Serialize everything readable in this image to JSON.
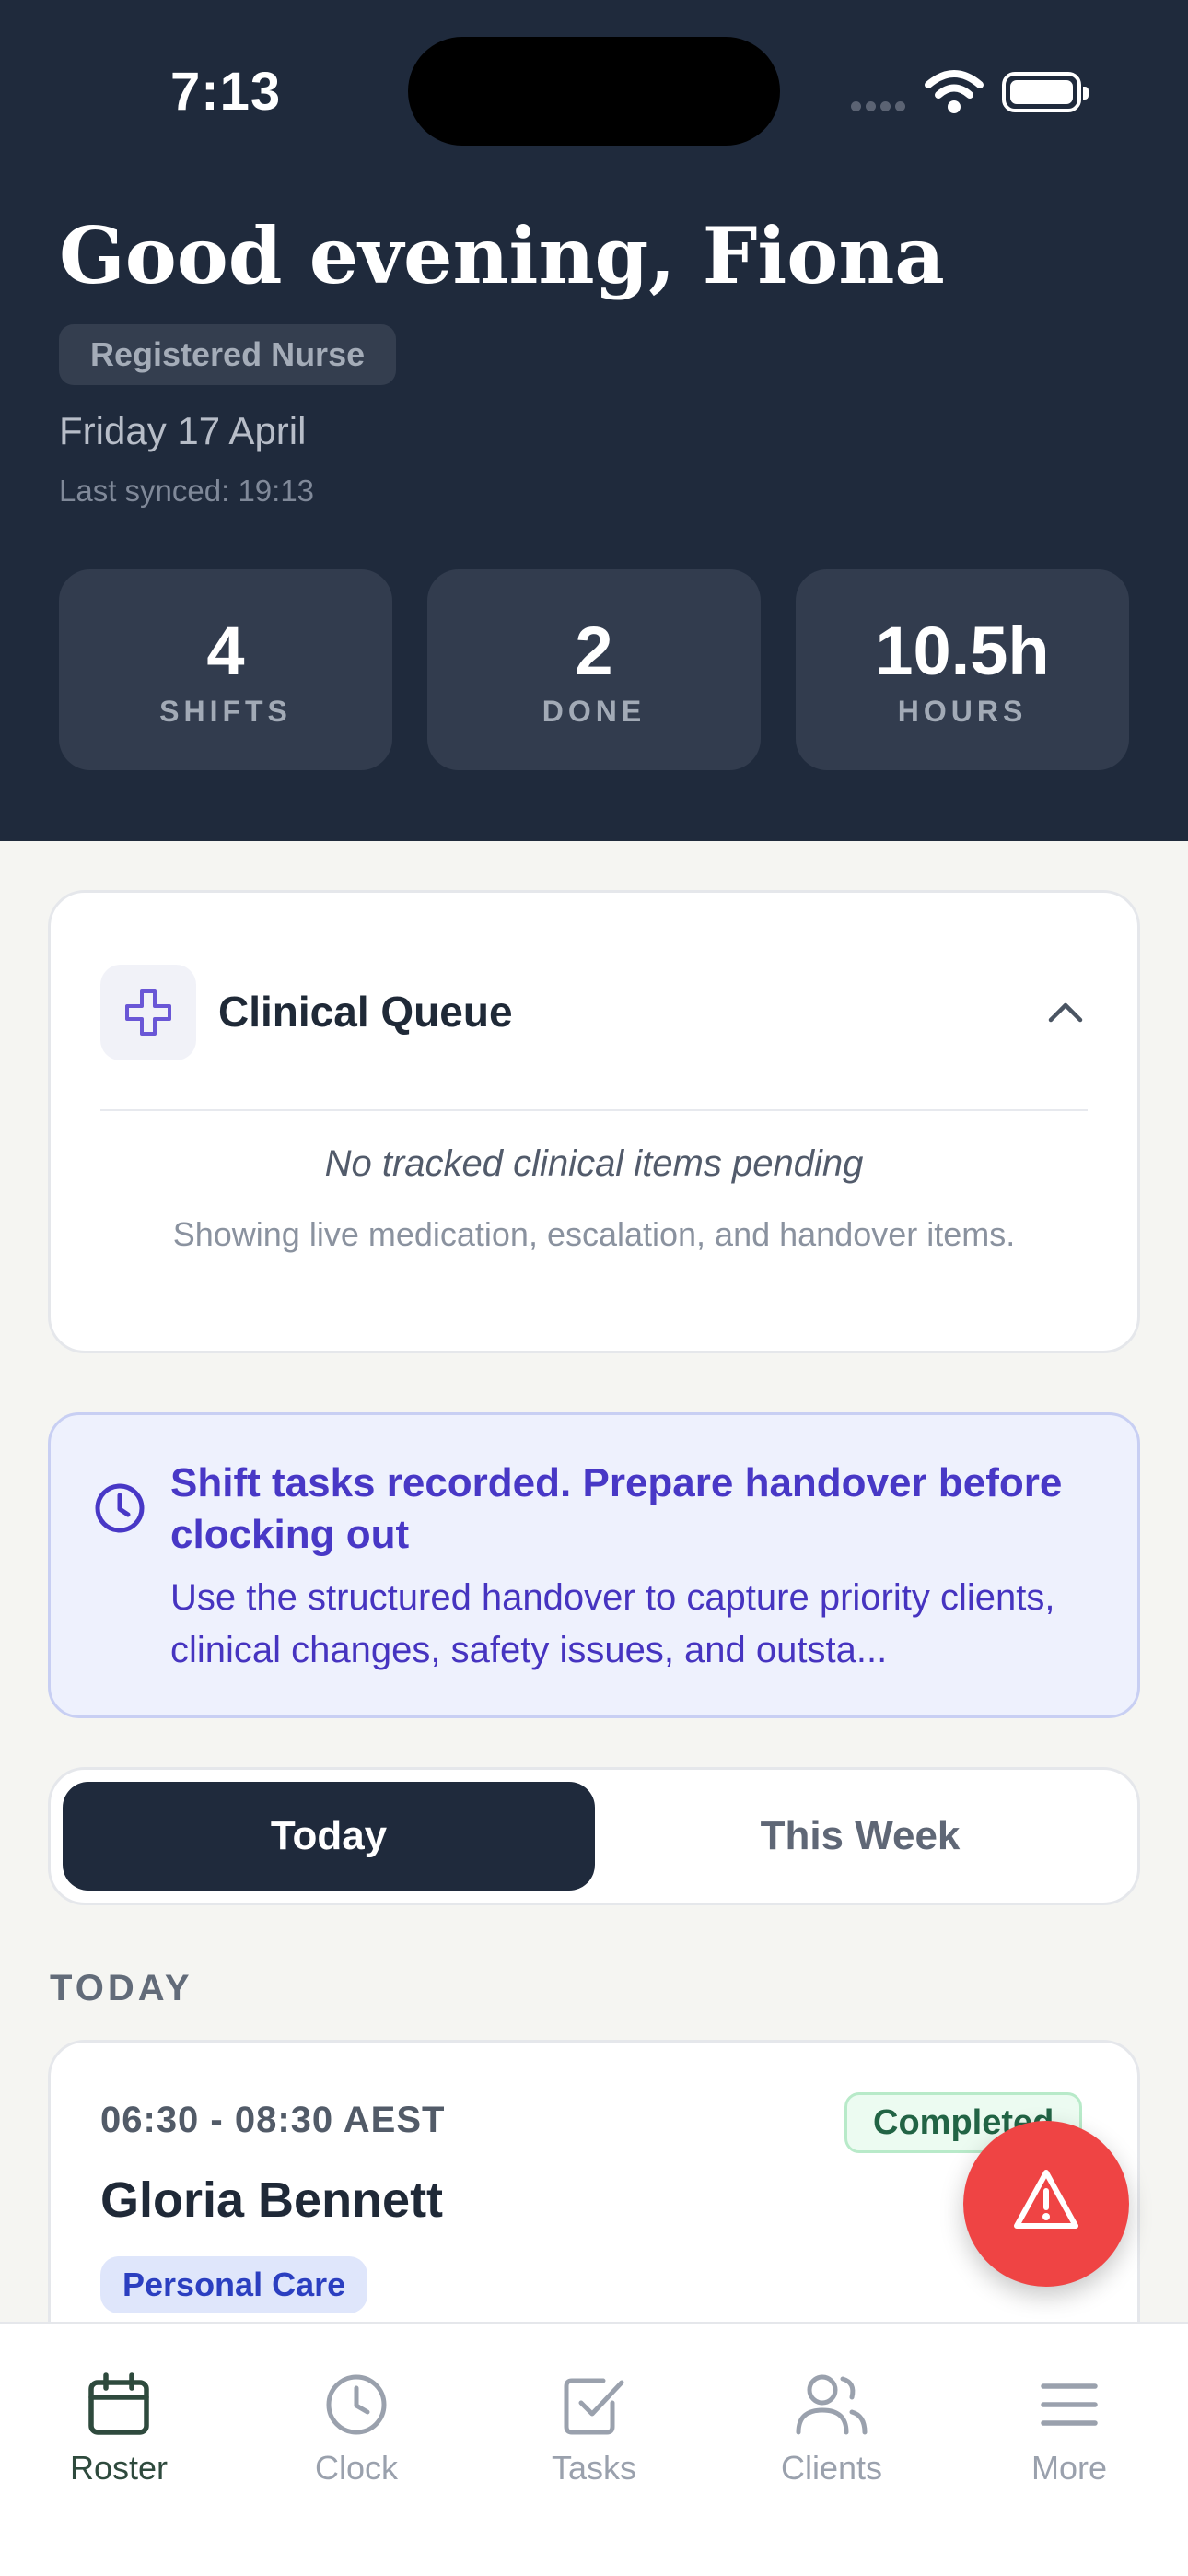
{
  "status_bar": {
    "time": "7:13"
  },
  "header": {
    "greeting": "Good evening, Fiona",
    "role": "Registered Nurse",
    "date": "Friday 17 April",
    "last_synced": "Last synced: 19:13",
    "stats": [
      {
        "value": "4",
        "label": "SHIFTS"
      },
      {
        "value": "2",
        "label": "DONE"
      },
      {
        "value": "10.5h",
        "label": "HOURS"
      }
    ]
  },
  "clinical_queue": {
    "title": "Clinical Queue",
    "icon": "medical-cross-icon",
    "empty_text": "No tracked clinical items pending",
    "subtext": "Showing live medication, escalation, and handover items."
  },
  "notice": {
    "icon": "clock-icon",
    "title": "Shift tasks recorded. Prepare handover before clocking out",
    "body": "Use the structured handover to capture priority clients, clinical changes, safety issues, and outsta..."
  },
  "segmented": {
    "today": "Today",
    "week": "This Week",
    "selected": "Today"
  },
  "section_label": "TODAY",
  "shift": {
    "time": "06:30 - 08:30 AEST",
    "status": "Completed",
    "client": "Gloria Bennett",
    "service": "Personal Care"
  },
  "fab": {
    "icon": "warning-triangle-icon"
  },
  "tabbar": {
    "items": [
      {
        "label": "Roster",
        "icon": "calendar-icon",
        "active": true
      },
      {
        "label": "Clock",
        "icon": "clock-icon"
      },
      {
        "label": "Tasks",
        "icon": "checkbox-icon"
      },
      {
        "label": "Clients",
        "icon": "users-icon"
      },
      {
        "label": "More",
        "icon": "menu-icon"
      }
    ]
  },
  "colors": {
    "header_bg": "#1f2a3c",
    "accent_indigo": "#4838c6",
    "danger": "#ef4444",
    "success": "#226445",
    "active_tab": "#2e4a3d"
  }
}
